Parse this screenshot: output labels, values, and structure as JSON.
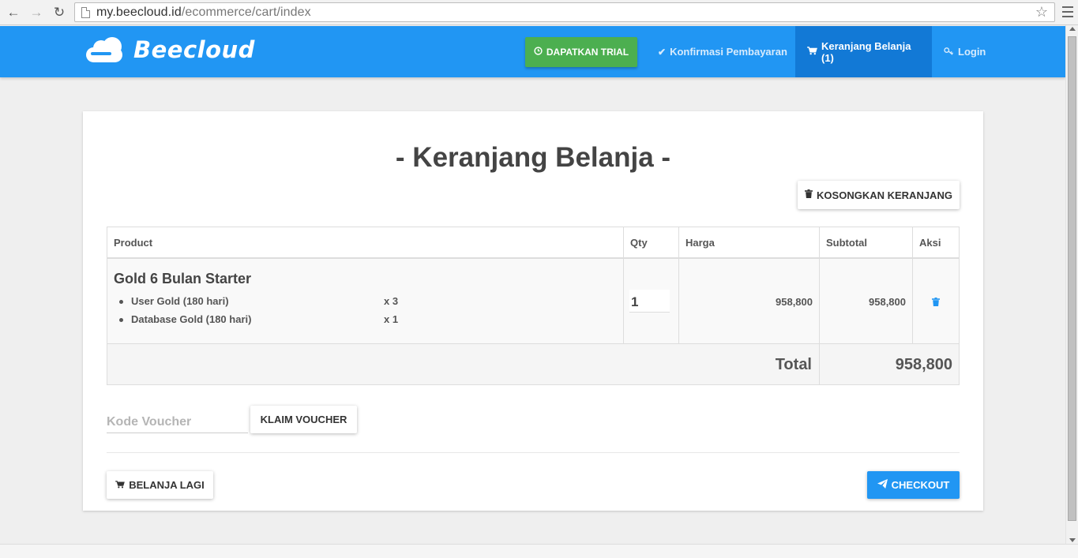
{
  "browser": {
    "url_host": "my.beecloud.id",
    "url_path": "/ecommerce/cart/index"
  },
  "nav": {
    "brand": "Beecloud",
    "trial_label": "DAPATKAN TRIAL",
    "confirm_label": "Konfirmasi Pembayaran",
    "cart_label": "Keranjang Belanja (1)",
    "login_label": "Login"
  },
  "page": {
    "title": "- Keranjang Belanja -",
    "empty_cart_label": "KOSONGKAN KERANJANG"
  },
  "table": {
    "headers": [
      "Product",
      "Qty",
      "Harga",
      "Subtotal",
      "Aksi"
    ],
    "rows": [
      {
        "product": "Gold 6 Bulan Starter",
        "items": [
          {
            "name": "User Gold (180 hari)",
            "qty": "x 3"
          },
          {
            "name": "Database Gold (180 hari)",
            "qty": "x 1"
          }
        ],
        "qty": "1",
        "price": "958,800",
        "subtotal": "958,800"
      }
    ],
    "total_label": "Total",
    "total_value": "958,800"
  },
  "voucher": {
    "placeholder": "Kode Voucher",
    "button_label": "KLAIM VOUCHER"
  },
  "footer": {
    "shop_label": "BELANJA LAGI",
    "checkout_label": "CHECKOUT"
  },
  "colors": {
    "primary": "#2196f3",
    "nav_active": "#1279d6",
    "success": "#4caf50"
  }
}
